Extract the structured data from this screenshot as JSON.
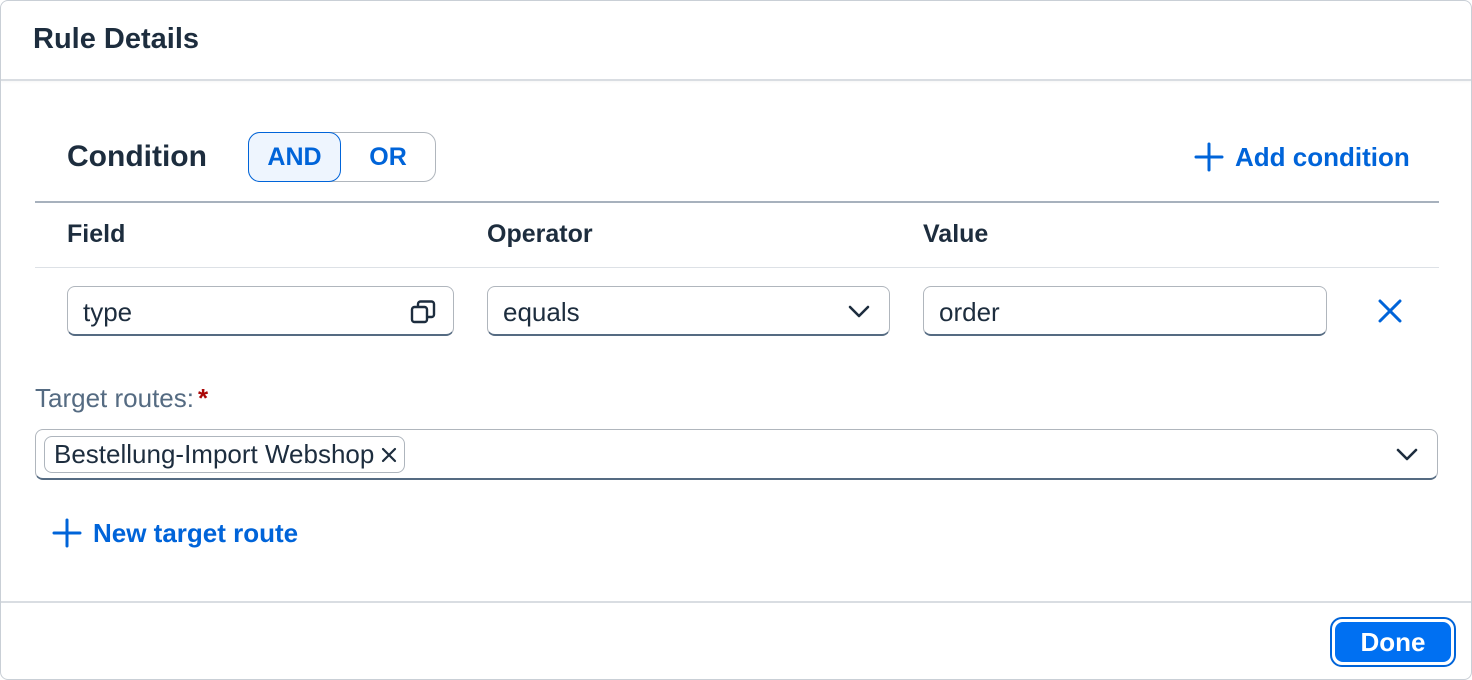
{
  "dialog": {
    "title": "Rule Details"
  },
  "condition": {
    "title": "Condition",
    "logic_options": [
      "AND",
      "OR"
    ],
    "selected_logic": "AND",
    "add_label": "Add condition",
    "columns": {
      "field": "Field",
      "operator": "Operator",
      "value": "Value"
    },
    "rows": [
      {
        "field": "type",
        "operator": "equals",
        "value": "order"
      }
    ]
  },
  "target_routes": {
    "label": "Target routes:",
    "required_marker": "*",
    "tokens": [
      "Bestellung-Import Webshop"
    ],
    "new_label": "New target route"
  },
  "footer": {
    "done_label": "Done"
  },
  "colors": {
    "accent": "#0064d9",
    "emphasized_button": "#0070f2",
    "text": "#1d2d3e",
    "label": "#556b82",
    "required": "#aa0808"
  }
}
